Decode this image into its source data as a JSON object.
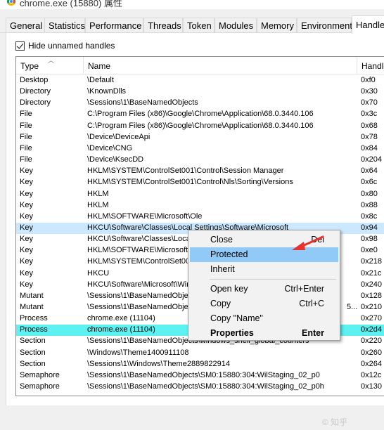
{
  "window": {
    "title": "chrome.exe (15880) 属性",
    "icon": "chrome-icon"
  },
  "tabs": [
    "General",
    "Statistics",
    "Performance",
    "Threads",
    "Token",
    "Modules",
    "Memory",
    "Environment",
    "Handle"
  ],
  "active_tab": "Handle",
  "hide_unnamed": {
    "label": "Hide unnamed handles",
    "checked": true
  },
  "columns": {
    "type": "Type",
    "name": "Name",
    "handle": "Handle"
  },
  "rows": [
    {
      "type": "Desktop",
      "name": "\\Default",
      "handle": "0xf0"
    },
    {
      "type": "Directory",
      "name": "\\KnownDlls",
      "handle": "0x30"
    },
    {
      "type": "Directory",
      "name": "\\Sessions\\1\\BaseNamedObjects",
      "handle": "0x70"
    },
    {
      "type": "File",
      "name": "C:\\Program Files (x86)\\Google\\Chrome\\Application\\68.0.3440.106",
      "handle": "0x3c"
    },
    {
      "type": "File",
      "name": "C:\\Program Files (x86)\\Google\\Chrome\\Application\\68.0.3440.106",
      "handle": "0x68"
    },
    {
      "type": "File",
      "name": "\\Device\\DeviceApi",
      "handle": "0x78"
    },
    {
      "type": "File",
      "name": "\\Device\\CNG",
      "handle": "0x84"
    },
    {
      "type": "File",
      "name": "\\Device\\KsecDD",
      "handle": "0x204"
    },
    {
      "type": "Key",
      "name": "HKLM\\SYSTEM\\ControlSet001\\Control\\Session Manager",
      "handle": "0x64"
    },
    {
      "type": "Key",
      "name": "HKLM\\SYSTEM\\ControlSet001\\Control\\Nls\\Sorting\\Versions",
      "handle": "0x6c"
    },
    {
      "type": "Key",
      "name": "HKLM",
      "handle": "0x80"
    },
    {
      "type": "Key",
      "name": "HKLM",
      "handle": "0x88"
    },
    {
      "type": "Key",
      "name": "HKLM\\SOFTWARE\\Microsoft\\Ole",
      "handle": "0x8c"
    },
    {
      "type": "Key",
      "name": "HKCU\\Software\\Classes\\Local Settings\\Software\\Microsoft",
      "handle": "0x94",
      "state": "light"
    },
    {
      "type": "Key",
      "name": "HKCU\\Software\\Classes\\Local S",
      "handle": "0x98"
    },
    {
      "type": "Key",
      "name": "HKLM\\SOFTWARE\\Microsoft\\Wi",
      "handle": "0xe0"
    },
    {
      "type": "Key",
      "name": "HKLM\\SYSTEM\\ControlSet001",
      "handle": "0x218"
    },
    {
      "type": "Key",
      "name": "HKCU",
      "handle": "0x21c"
    },
    {
      "type": "Key",
      "name": "HKCU\\Software\\Microsoft\\Windo",
      "handle": "0x240"
    },
    {
      "type": "Mutant",
      "name": "\\Sessions\\1\\BaseNamedObjects",
      "handle": "0x128"
    },
    {
      "type": "Mutant",
      "name": "\\Sessions\\1\\BaseNamedObjects",
      "handle": "0x210"
    },
    {
      "type": "Process",
      "name": "chrome.exe (11104)",
      "handle": "0x270"
    },
    {
      "type": "Process",
      "name": "chrome.exe (11104)",
      "handle": "0x2d4",
      "state": "cyan"
    },
    {
      "type": "Section",
      "name": "\\Sessions\\1\\BaseNamedObjects\\windows_shell_global_counters",
      "handle": "0x220"
    },
    {
      "type": "Section",
      "name": "\\Windows\\Theme1400911108",
      "handle": "0x260"
    },
    {
      "type": "Section",
      "name": "\\Sessions\\1\\Windows\\Theme2889822914",
      "handle": "0x264"
    },
    {
      "type": "Semaphore",
      "name": "\\Sessions\\1\\BaseNamedObjects\\SM0:15880:304:WilStaging_02_p0",
      "handle": "0x12c"
    },
    {
      "type": "Semaphore",
      "name": "\\Sessions\\1\\BaseNamedObjects\\SM0:15880:304:WilStaging_02_p0h",
      "handle": "0x130"
    }
  ],
  "mutant_overflow": "5...",
  "context_menu": [
    {
      "label": "Close",
      "shortcut": "Del"
    },
    {
      "label": "Protected",
      "shortcut": "",
      "highlight": true
    },
    {
      "label": "Inherit",
      "shortcut": ""
    },
    {
      "separator": true
    },
    {
      "label": "Open key",
      "shortcut": "Ctrl+Enter"
    },
    {
      "label": "Copy",
      "shortcut": "Ctrl+C"
    },
    {
      "label": "Copy \"Name\"",
      "shortcut": ""
    },
    {
      "label": "Properties",
      "shortcut": "Enter",
      "bold": true
    }
  ],
  "annotation": {
    "icon": "red-arrow-icon",
    "color": "#e8322c"
  },
  "colors": {
    "selection_light": "#cce8ff",
    "selection_cyan": "#5df1f1",
    "menu_highlight": "#91c9f7"
  },
  "watermark": "©  知乎"
}
